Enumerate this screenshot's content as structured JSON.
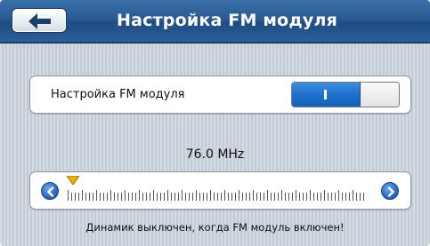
{
  "header": {
    "title": "Настройка FM модуля",
    "back_icon": "arrow-left-icon"
  },
  "setting": {
    "label": "Настройка FM модуля",
    "toggle_state": "on",
    "accent": "#1f6fcc"
  },
  "frequency": {
    "display": "76.0 MHz",
    "value_fraction": 0.0
  },
  "slider": {
    "left_icon": "chevron-left-icon",
    "right_icon": "chevron-right-icon"
  },
  "notice": "Динамик выключен, когда FM модуль включен!"
}
